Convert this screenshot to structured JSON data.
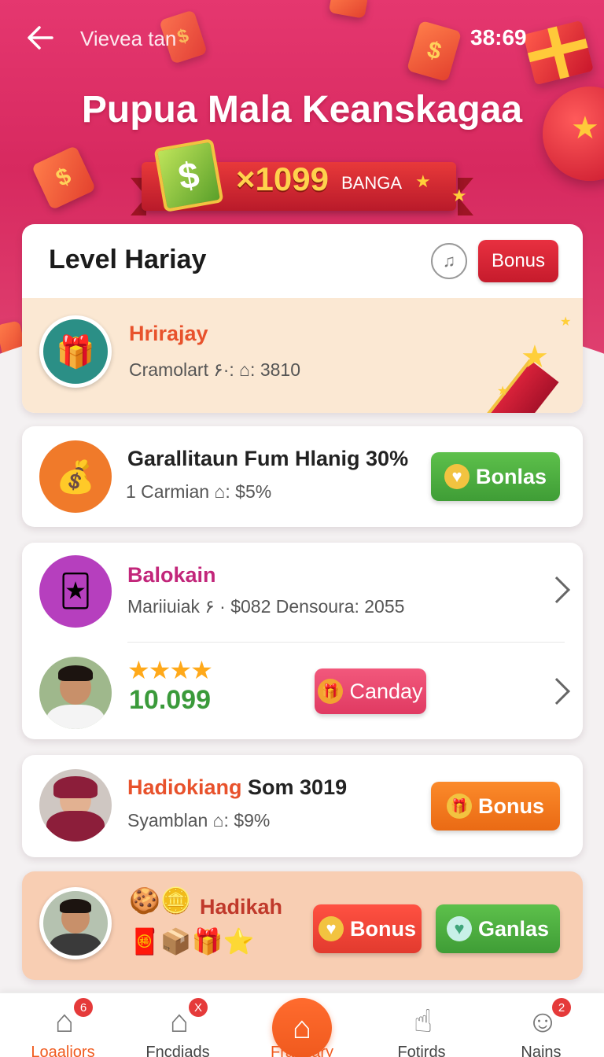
{
  "header": {
    "back_icon": "arrow-left-icon",
    "subtitle": "Vievea tan",
    "counter": "38:69",
    "title": "Pupua Mala Keanskagaa"
  },
  "banner": {
    "amount": "×1099",
    "unit": "BANGA",
    "icon": "cash-icon"
  },
  "level_card": {
    "title": "Level Hariay",
    "music_icon": "music-note-icon",
    "bonus_label": "Bonus",
    "row": {
      "name": "Hrirajay",
      "detail": "Cramolart ۶·: ⌂: 3810",
      "icon": "gift-box-icon"
    }
  },
  "items": [
    {
      "title": "Garallitaun Fum Hlanig 30%",
      "detail": "1 Carmian ⌂: $5%",
      "button": "Bonlas",
      "icon": "money-bag-icon",
      "button_icon": "heart-coin-icon"
    },
    {
      "title": "Balokain",
      "detail": "Mariiuiak ۶ · $082 Densoura: 2055",
      "icon": "card-pack-icon"
    },
    {
      "stars": "★★★★",
      "score": "10.099",
      "button": "Canday",
      "button_icon": "gift-icon"
    },
    {
      "title_highlight": "Hadiokiang",
      "title_rest": " Som 3019",
      "detail": "Syamblan ⌂: $9%",
      "button": "Bonus",
      "button_icon": "gift-icon"
    },
    {
      "title": "Hadikah",
      "button_left": "Bonus",
      "button_right": "Ganlas",
      "button_left_icon": "heart-coin-icon",
      "button_right_icon": "heart-icon"
    }
  ],
  "nav": [
    {
      "label": "Loaaliors",
      "badge": "6",
      "icon": "home-outline-icon"
    },
    {
      "label": "Fncdiads",
      "badge": "X",
      "icon": "shop-icon"
    },
    {
      "label": "Fraudary",
      "icon": "home-icon",
      "active": true
    },
    {
      "label": "Fotirds",
      "icon": "thumb-icon"
    },
    {
      "label": "Nains",
      "badge": "2",
      "icon": "chat-icon"
    }
  ],
  "colors": {
    "hero": "#d7295f",
    "accent_orange": "#f05a1e",
    "green": "#4caf3f",
    "red": "#d62435"
  }
}
